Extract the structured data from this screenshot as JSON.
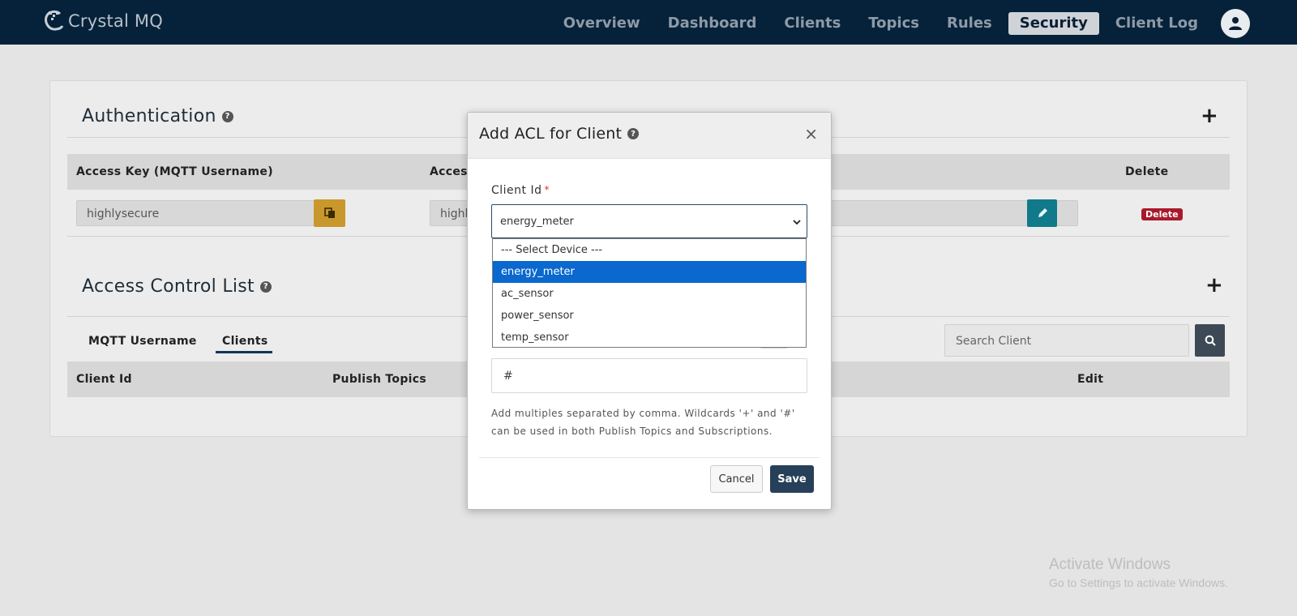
{
  "app": {
    "logo_text": "Crystal MQ"
  },
  "nav": {
    "items": [
      "Overview",
      "Dashboard",
      "Clients",
      "Topics",
      "Rules",
      "Security",
      "Client Log"
    ],
    "active": "Security"
  },
  "authentication": {
    "title": "Authentication",
    "columns": {
      "access_key": "Access Key (MQTT Username)",
      "access_secret_partial": "Access",
      "delete": "Delete"
    },
    "row": {
      "access_key": "highlysecure",
      "access_secret_partial": "highly",
      "delete_label": "Delete"
    }
  },
  "acl": {
    "title": "Access Control List",
    "tabs": [
      "MQTT Username",
      "Clients"
    ],
    "active_tab": "Clients",
    "search_placeholder": "Search Client",
    "columns": {
      "client_id": "Client Id",
      "publish_topics": "Publish Topics",
      "edit": "Edit"
    }
  },
  "modal": {
    "title": "Add ACL for Client",
    "close_symbol": "×",
    "client_id_label": "Client Id",
    "required_mark": "*",
    "selected_value": "energy_meter",
    "options": [
      "--- Select Device ---",
      "energy_meter",
      "ac_sensor",
      "power_sensor",
      "temp_sensor"
    ],
    "topic_value": "#",
    "help_text": "Add multiples separated by comma. Wildcards '+' and '#' can be used in both Publish Topics and Subscriptions.",
    "cancel_label": "Cancel",
    "save_label": "Save"
  },
  "watermark": {
    "line1": "Activate Windows",
    "line2": "Go to Settings to activate Windows."
  }
}
